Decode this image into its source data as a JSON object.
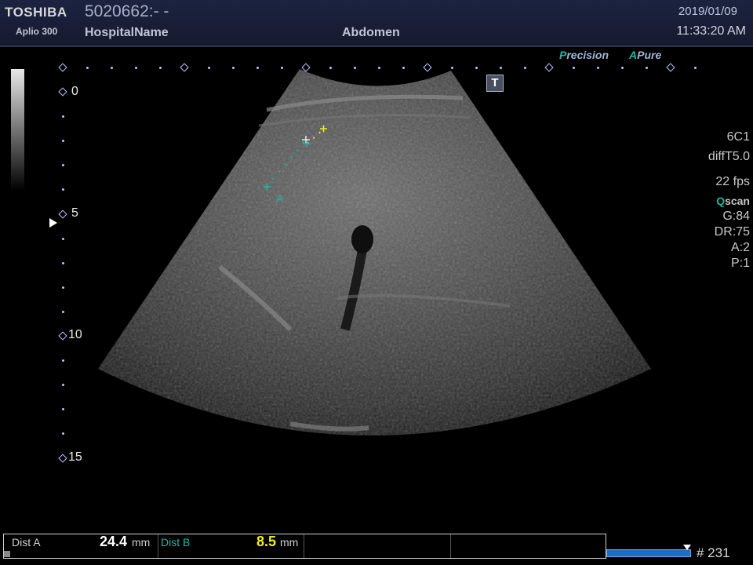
{
  "header": {
    "brand": "TOSHIBA",
    "model": "Aplio 300",
    "patient_id": "5020662:- -",
    "hospital": "HospitalName",
    "exam": "Abdomen",
    "date": "2019/01/09",
    "time": "11:33:20 AM"
  },
  "modes": {
    "precision_letter": "P",
    "precision_rest": "recision",
    "apure_letter": "A",
    "apure_rest": "Pure"
  },
  "t_icon": "T",
  "depth_scale": [
    "0",
    "5",
    "10",
    "15"
  ],
  "right_panel": {
    "probe": "6C1",
    "preset": "diffT5.0",
    "fps": "22 fps",
    "qscan_q": "Q",
    "qscan_rest": "scan",
    "gain": "G:84",
    "dynamic_range": "DR:75",
    "a_value": "A:2",
    "p_value": "P:1"
  },
  "caliper_label": "A",
  "status_bar": {
    "dist_a_label": "Dist A",
    "dist_a_value": "24.4",
    "dist_a_unit": "mm",
    "dist_b_label": "Dist B",
    "dist_b_value": "8.5",
    "dist_b_unit": "mm"
  },
  "frame_number": "# 231",
  "colors": {
    "accent_teal": "#23b5a5",
    "dist_b_yellow": "#f0f020",
    "cine_blue": "#1c6cc8"
  }
}
